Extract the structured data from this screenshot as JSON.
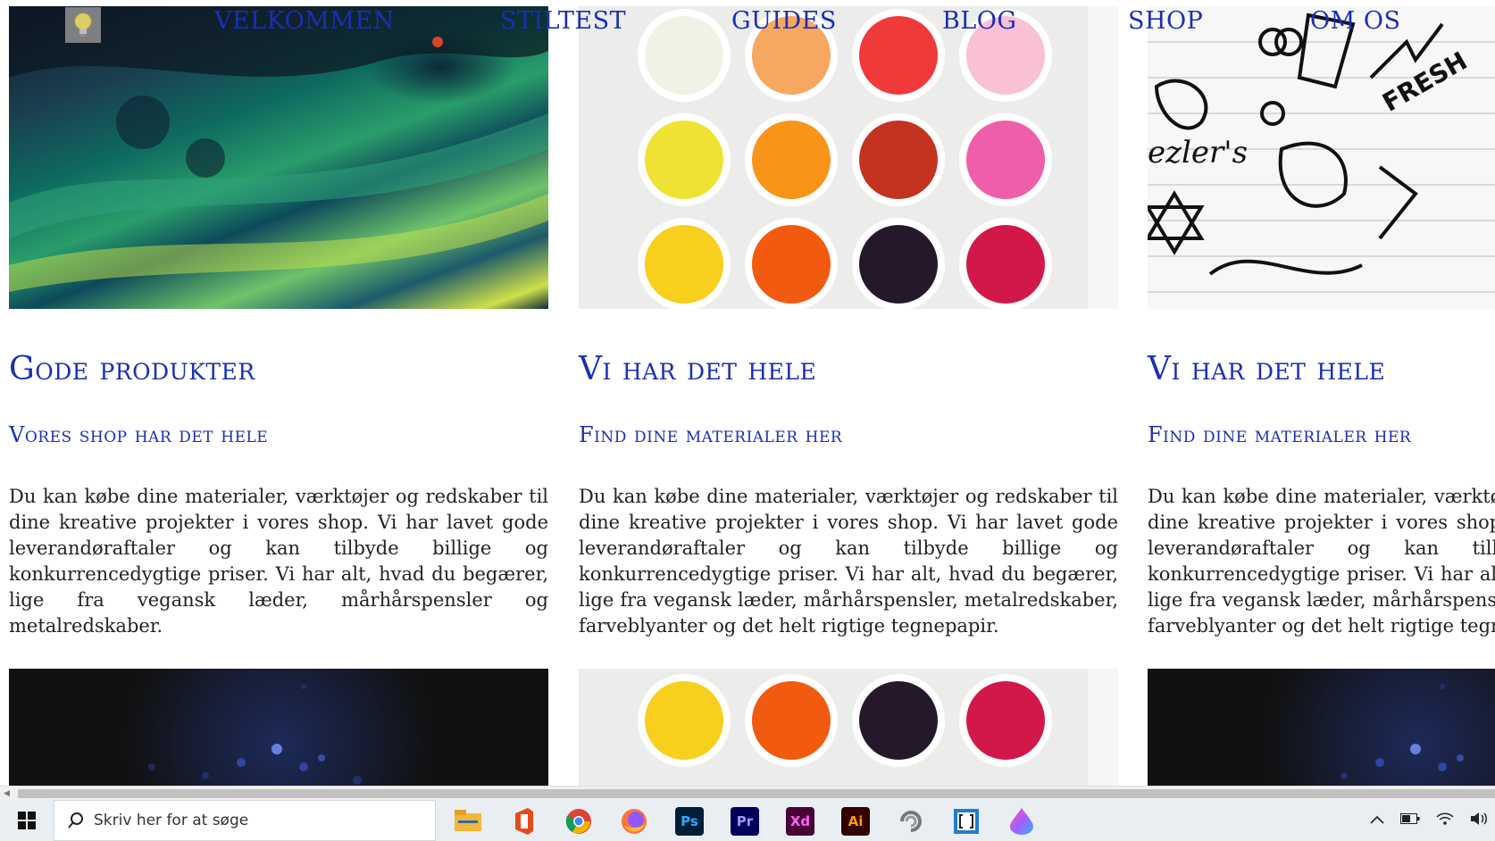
{
  "nav": {
    "items": [
      "Velkommen",
      "Stiltest",
      "Guides",
      "Blog",
      "Shop",
      "Om os"
    ]
  },
  "columns": [
    {
      "heading": "Gode produkter",
      "subheading": "Vores shop har det hele",
      "text": "Du kan købe dine materialer, værktøjer og redskaber til dine kreative projekter i vores shop. Vi har lavet gode leverandøraftaler og kan tilbyde billige og konkurrencedygtige priser. Vi har alt, hvad du begærer, lige fra vegansk læder, mårhårspensler og metalredskaber."
    },
    {
      "heading": "Vi har det hele",
      "subheading": "Find dine materialer her",
      "text": "Du kan købe dine materialer, værktøjer og redskaber til dine kreative projekter i vores shop. Vi har lavet gode leverandøraftaler og kan tilbyde billige og konkurrencedygtige priser. Vi har alt, hvad du begærer, lige fra vegansk læder, mårhårspensler, metalredskaber, farveblyanter og det helt rigtige tegnepapir."
    },
    {
      "heading": "Vi har det hele",
      "subheading": "Find dine materialer her",
      "text": "Du kan købe dine materialer, værktøjer og redskaber til dine kreative projekter i vores shop. Vi har lavet gode leverandøraftaler og kan tilbyde billige og konkurrencedygtige priser. Vi har alt, hvad du begærer, lige fra vegansk læder, mårhårspensler, metalredskaber, farveblyanter og det helt rigtige tegnepapir."
    }
  ],
  "taskbar": {
    "search_placeholder": "Skriv her for at søge",
    "apps": [
      {
        "name": "file-explorer-icon",
        "label": "",
        "color": "#f3b73a"
      },
      {
        "name": "office-icon",
        "label": "",
        "color": "#e64a19"
      },
      {
        "name": "chrome-icon",
        "label": "",
        "color": "#4285f4"
      },
      {
        "name": "firefox-icon",
        "label": "",
        "color": "#ff7139"
      },
      {
        "name": "photoshop-icon",
        "label": "Ps",
        "color": "#001e36"
      },
      {
        "name": "premiere-icon",
        "label": "Pr",
        "color": "#00005b"
      },
      {
        "name": "xd-icon",
        "label": "Xd",
        "color": "#470137"
      },
      {
        "name": "illustrator-icon",
        "label": "Ai",
        "color": "#330000"
      },
      {
        "name": "app-swirl-icon",
        "label": "",
        "color": "#888888"
      },
      {
        "name": "brackets-icon",
        "label": "",
        "color": "#1f7dd4"
      },
      {
        "name": "paint-drop-icon",
        "label": "",
        "color": "#7a5cff"
      }
    ]
  },
  "colors": {
    "accent": "#1a2fb5",
    "body_text": "#222222"
  }
}
